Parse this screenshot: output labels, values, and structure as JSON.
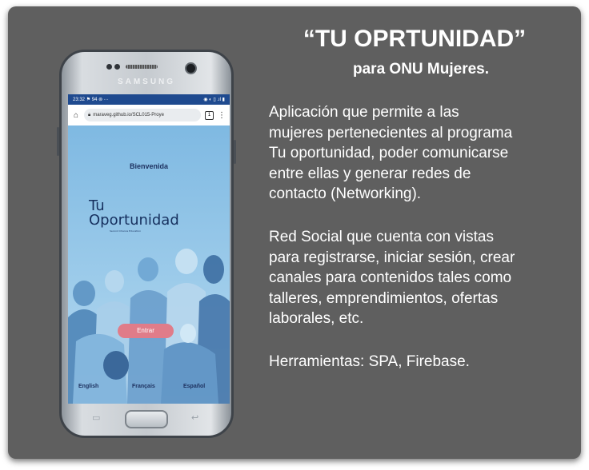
{
  "title": "“TU OPRTUNIDAD”",
  "subtitle": "para ONU Mujeres.",
  "description": [
    "Aplicación  que permite a las",
    "mujeres pertenecientes  al programa",
    "Tu oportunidad, poder comunicarse",
    "entre ellas y generar redes de",
    "contacto (Networking)."
  ],
  "features": [
    "Red Social que cuenta con vistas",
    "para registrarse, iniciar sesión, crear",
    "canales para  contenidos tales como",
    "talleres, emprendimientos, ofertas",
    "laborales, etc."
  ],
  "tools": "Herramientas: SPA,  Firebase.",
  "phone": {
    "brand": "SAMSUNG",
    "status_time": "23:32",
    "status_icons": "⚑ 94 ⊚ ···",
    "status_right": "◉ ◐ ▯ .ıl ▮",
    "url": "maraveg.github.io/SCL015-Proye",
    "tab_count": "1",
    "app": {
      "welcome": "Bienvenida",
      "logo_line1": "Tu",
      "logo_line2": "Oportunidad",
      "logo_tagline": "Second Chance Education",
      "enter_label": "Entrar",
      "languages": [
        "English",
        "Français",
        "Español"
      ]
    }
  },
  "colors": {
    "card_bg": "#5f5f5f",
    "text": "#ffffff",
    "status_bar": "#1f4a8f",
    "app_bg": "#8fc1e3",
    "enter_button": "#e07c89",
    "logo": "#16305e"
  }
}
